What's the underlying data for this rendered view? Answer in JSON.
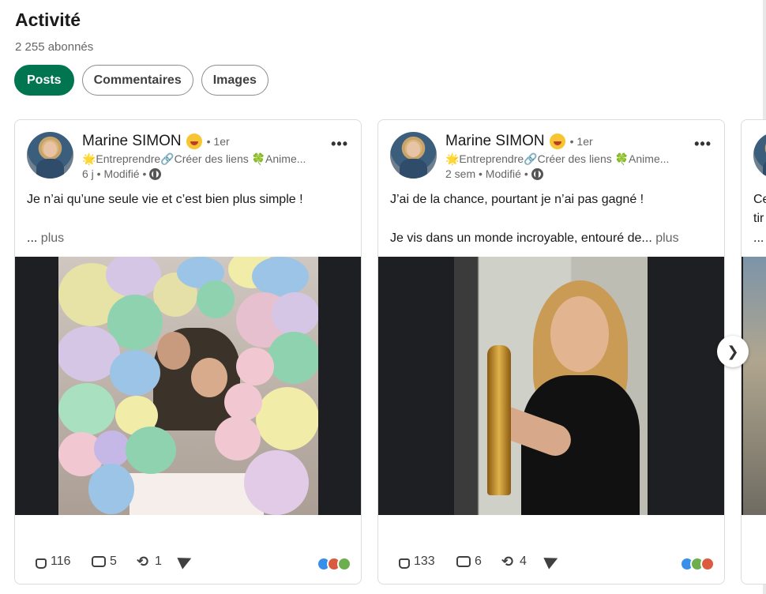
{
  "header": {
    "title": "Activité",
    "followers": "2 255 abonnés"
  },
  "tabs": [
    {
      "label": "Posts",
      "active": true
    },
    {
      "label": "Commentaires",
      "active": false
    },
    {
      "label": "Images",
      "active": false
    }
  ],
  "posts": [
    {
      "author": "Marine SIMON",
      "degree": "• 1er",
      "headline": "🌟Entreprendre🔗Créer des liens 🍀Anime...",
      "meta": "6 j • Modifié •",
      "text_line1": "Je n’ai qu’une seule vie et c’est bien plus simple !",
      "text_line2": "...",
      "more_label": "plus",
      "image_alt": "photo de ballons",
      "likes": "116",
      "comments": "5",
      "reposts": "1",
      "reaction_colors": [
        "#378fe9",
        "#dc5a3f",
        "#6dae4f"
      ]
    },
    {
      "author": "Marine SIMON",
      "degree": "• 1er",
      "headline": "🌟Entreprendre🔗Créer des liens 🍀Anime...",
      "meta": "2 sem • Modifié •",
      "text_line1": "J’ai de la chance, pourtant je n’ai pas gagné !",
      "text_line2": "Je vis dans un monde incroyable, entouré de...",
      "more_label": "plus",
      "image_alt": "photo avec trophée",
      "likes": "133",
      "comments": "6",
      "reposts": "4",
      "reaction_colors": [
        "#378fe9",
        "#6dae4f",
        "#dc5a3f"
      ]
    }
  ],
  "peek": {
    "line1": "Ce",
    "line2": "tir",
    "line3": "..."
  },
  "next_button": "❯",
  "colors": {
    "accent": "#01754f"
  }
}
